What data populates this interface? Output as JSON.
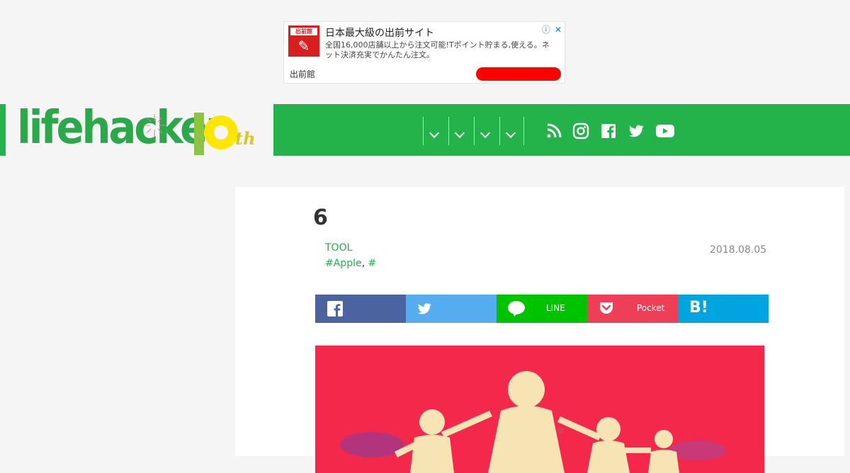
{
  "ad": {
    "logo_top": "出前館",
    "title": "日本最大級の出前サイト",
    "description": "全国16,000店舗以上から注文可能!Tポイント貯まる,使える。ネット決済充実でかんたん注文。",
    "brand": "出前館",
    "info_icon": "ⓘ",
    "close_icon": "✕"
  },
  "header": {
    "logo_text": "lifehacker",
    "anniversary_suffix": "th",
    "nav_items": [
      "",
      "",
      "",
      ""
    ],
    "social": [
      "rss-icon",
      "instagram-icon",
      "facebook-icon",
      "twitter-icon",
      "youtube-icon"
    ]
  },
  "article": {
    "title": "6",
    "category": "TOOL",
    "tags": [
      "#Apple",
      "#"
    ],
    "tag_separator": ", ",
    "date": "2018.08.05",
    "share": [
      {
        "name": "facebook",
        "label": "",
        "color": "#4b64a0"
      },
      {
        "name": "twitter",
        "label": "",
        "color": "#55acee"
      },
      {
        "name": "line",
        "label": "LINE",
        "color": "#00c300"
      },
      {
        "name": "pocket",
        "label": "Pocket",
        "color": "#ef3f56"
      },
      {
        "name": "hatena",
        "label": "",
        "color": "#00a4de"
      }
    ]
  },
  "colors": {
    "brand_green": "#24b24a",
    "hero_bg": "#f4284b"
  }
}
